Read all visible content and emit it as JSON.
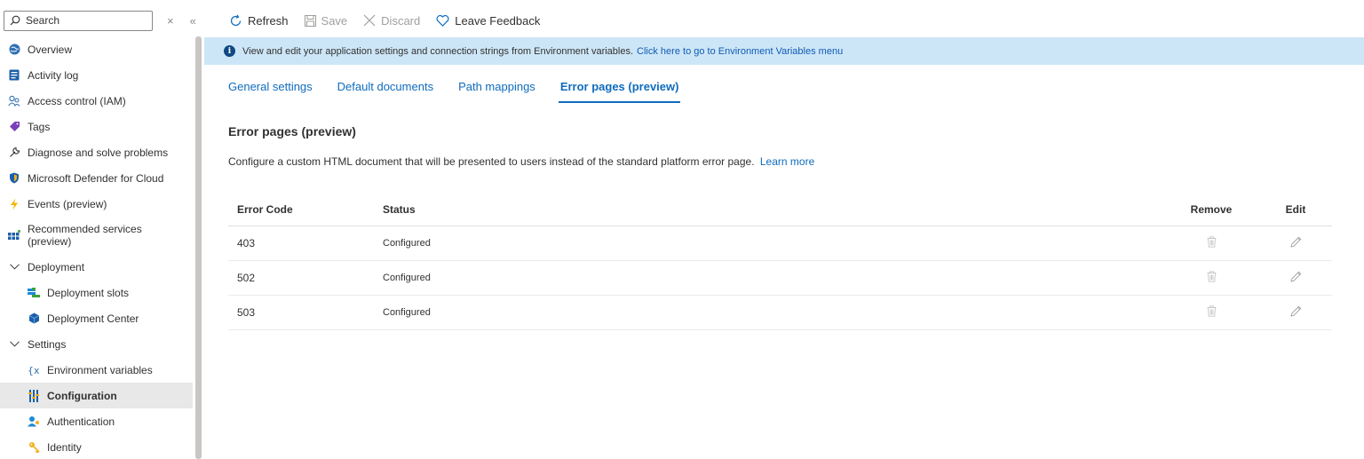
{
  "sidebar": {
    "search_placeholder": "Search",
    "close_glyph": "×",
    "collapse_glyph": "«",
    "items": [
      {
        "label": "Overview",
        "icon": "globe-icon"
      },
      {
        "label": "Activity log",
        "icon": "activity-log-icon"
      },
      {
        "label": "Access control (IAM)",
        "icon": "people-icon"
      },
      {
        "label": "Tags",
        "icon": "tag-icon"
      },
      {
        "label": "Diagnose and solve problems",
        "icon": "wrench-icon"
      },
      {
        "label": "Microsoft Defender for Cloud",
        "icon": "shield-icon"
      },
      {
        "label": "Events (preview)",
        "icon": "lightning-icon"
      },
      {
        "label": "Recommended services\n(preview)",
        "icon": "grid-icon"
      },
      {
        "label": "Deployment",
        "icon": "chevron-down-icon"
      },
      {
        "label": "Deployment slots",
        "icon": "slots-icon"
      },
      {
        "label": "Deployment Center",
        "icon": "cube-icon"
      },
      {
        "label": "Settings",
        "icon": "chevron-down-icon"
      },
      {
        "label": "Environment variables",
        "icon": "variable-icon"
      },
      {
        "label": "Configuration",
        "icon": "sliders-icon"
      },
      {
        "label": "Authentication",
        "icon": "user-key-icon"
      },
      {
        "label": "Identity",
        "icon": "key-icon"
      }
    ]
  },
  "toolbar": {
    "refresh": "Refresh",
    "save": "Save",
    "discard": "Discard",
    "feedback": "Leave Feedback"
  },
  "info_bar": {
    "text": "View and edit your application settings and connection strings from Environment variables.",
    "link": "Click here to go to Environment Variables menu"
  },
  "tabs": [
    {
      "label": "General settings"
    },
    {
      "label": "Default documents"
    },
    {
      "label": "Path mappings"
    },
    {
      "label": "Error pages (preview)",
      "active": true
    }
  ],
  "section": {
    "title": "Error pages (preview)",
    "description": "Configure a custom HTML document that will be presented to users instead of the standard platform error page.",
    "learn_more": "Learn more"
  },
  "table": {
    "headers": {
      "code": "Error Code",
      "status": "Status",
      "remove": "Remove",
      "edit": "Edit"
    },
    "rows": [
      {
        "code": "403",
        "status": "Configured"
      },
      {
        "code": "502",
        "status": "Configured"
      },
      {
        "code": "503",
        "status": "Configured"
      }
    ]
  },
  "colors": {
    "accent": "#0f6cbd",
    "info_bg": "#cde6f7",
    "selected_bg": "#e8e8e8"
  }
}
